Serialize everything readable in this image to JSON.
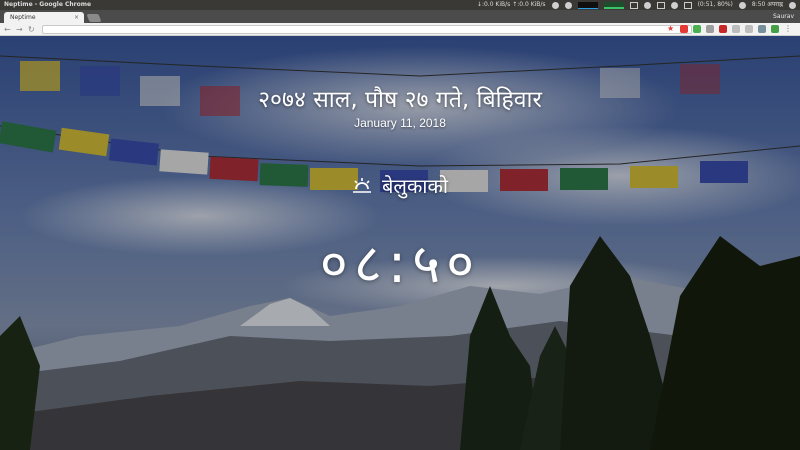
{
  "os_panel": {
    "window_title": "Neptime - Google Chrome",
    "net_speed": "↓:0.0 KiB/s ↑:0.0 KiB/s",
    "battery": "(0:51, 80%)",
    "clock": "8:50 अपराह्न"
  },
  "browser": {
    "tab_title": "Neptime",
    "tab_close": "×",
    "profile": "Saurav",
    "url": ""
  },
  "page": {
    "nepali_date": "२०७४ साल, पौष २७ गते, बिहिवार",
    "english_date": "January 11, 2018",
    "period_label": "बेलुकाको",
    "time": "०८:५०"
  },
  "icons": {
    "back": "back-icon",
    "forward": "forward-icon",
    "reload": "reload-icon",
    "period": "sunset-icon"
  }
}
